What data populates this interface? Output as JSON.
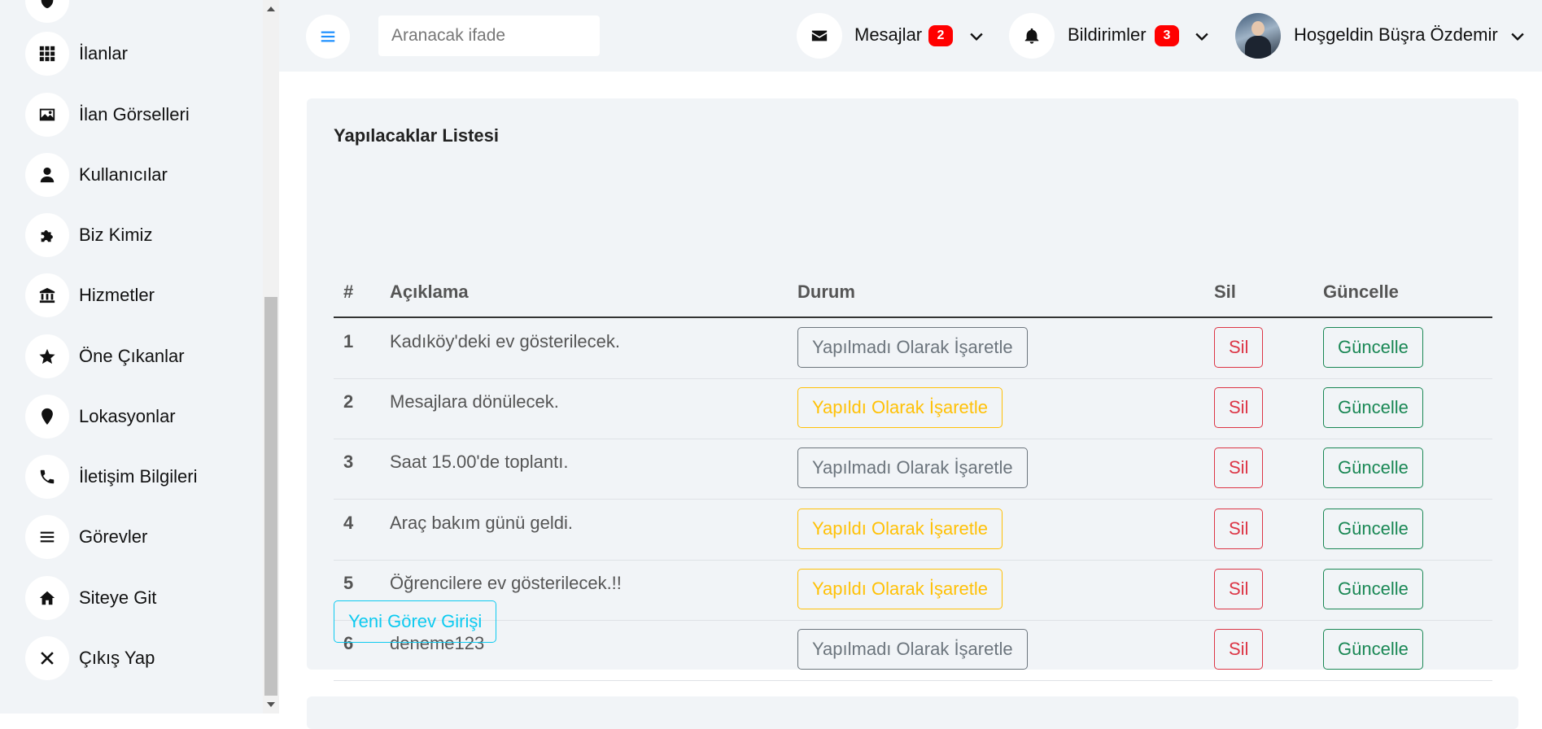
{
  "sidebar": {
    "items": [
      {
        "label": "İlanlar",
        "icon": "grid-icon"
      },
      {
        "label": "İlan Görselleri",
        "icon": "image-icon"
      },
      {
        "label": "Kullanıcılar",
        "icon": "user-icon"
      },
      {
        "label": "Biz Kimiz",
        "icon": "puzzle-icon"
      },
      {
        "label": "Hizmetler",
        "icon": "bank-icon"
      },
      {
        "label": "Öne Çıkanlar",
        "icon": "star-icon"
      },
      {
        "label": "Lokasyonlar",
        "icon": "map-pin-icon"
      },
      {
        "label": "İletişim Bilgileri",
        "icon": "phone-icon"
      },
      {
        "label": "Görevler",
        "icon": "bars-icon"
      },
      {
        "label": "Siteye Git",
        "icon": "home-icon"
      },
      {
        "label": "Çıkış Yap",
        "icon": "close-icon"
      }
    ]
  },
  "topbar": {
    "search_placeholder": "Aranacak ifade",
    "messages_label": "Mesajlar",
    "messages_count": "2",
    "notifications_label": "Bildirimler",
    "notifications_count": "3",
    "welcome_text": "Hoşgeldin Büşra Özdemir"
  },
  "todo": {
    "title": "Yapılacaklar Listesi",
    "headers": {
      "num": "#",
      "desc": "Açıklama",
      "status": "Durum",
      "delete": "Sil",
      "update": "Güncelle"
    },
    "rows": [
      {
        "num": "1",
        "desc": "Kadıköy'deki ev gösterilecek.",
        "status_label": "Yapılmadı Olarak İşaretle",
        "done": true
      },
      {
        "num": "2",
        "desc": "Mesajlara dönülecek.",
        "status_label": "Yapıldı Olarak İşaretle",
        "done": false
      },
      {
        "num": "3",
        "desc": "Saat 15.00'de toplantı.",
        "status_label": "Yapılmadı Olarak İşaretle",
        "done": true
      },
      {
        "num": "4",
        "desc": "Araç bakım günü geldi.",
        "status_label": "Yapıldı Olarak İşaretle",
        "done": false
      },
      {
        "num": "5",
        "desc": "Öğrencilere ev gösterilecek.!!",
        "status_label": "Yapıldı Olarak İşaretle",
        "done": false
      },
      {
        "num": "6",
        "desc": "deneme123",
        "status_label": "Yapılmadı Olarak İşaretle",
        "done": true
      }
    ],
    "delete_label": "Sil",
    "update_label": "Güncelle",
    "new_task_label": "Yeni Görev Girişi"
  },
  "colors": {
    "secondary": "#6c757d",
    "warning": "#ffc107",
    "danger": "#dc3545",
    "success": "#198754",
    "info": "#0dcaf0",
    "badge": "#ff0000",
    "menu_accent": "#1e90ff"
  }
}
